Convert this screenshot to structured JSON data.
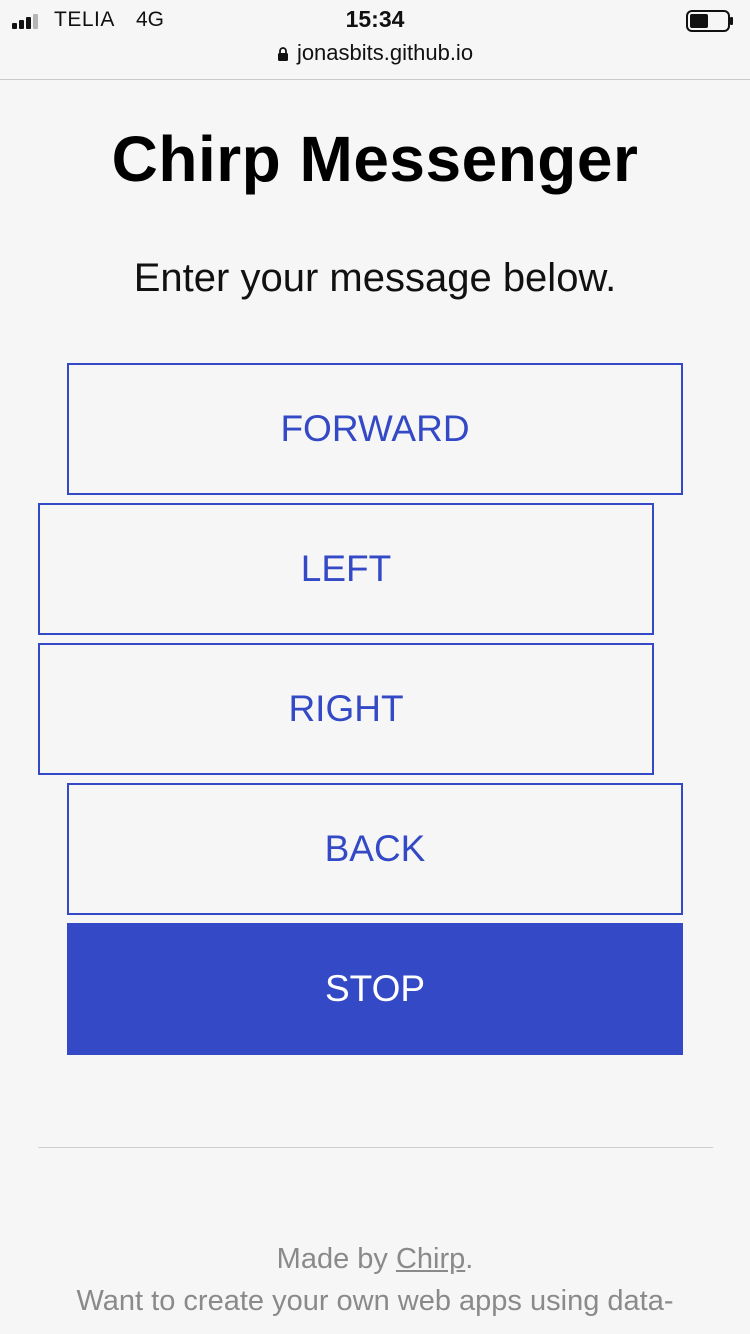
{
  "status_bar": {
    "carrier": "TELIA",
    "network": "4G",
    "time": "15:34",
    "url": "jonasbits.github.io",
    "icons": [
      "signal-icon",
      "lock-icon",
      "battery-icon"
    ]
  },
  "page": {
    "title": "Chirp Messenger",
    "subtitle": "Enter your message below."
  },
  "buttons": [
    {
      "label": "FORWARD"
    },
    {
      "label": "LEFT"
    },
    {
      "label": "RIGHT"
    },
    {
      "label": "BACK"
    },
    {
      "label": "STOP"
    }
  ],
  "footer": {
    "made_by_prefix": "Made by ",
    "made_by_link": "Chirp",
    "made_by_suffix": ".",
    "line2": "Want to create your own web apps using data-"
  },
  "colors": {
    "accent": "#3349c5",
    "background": "#f6f6f6",
    "footer_text": "#8a8a8a"
  }
}
